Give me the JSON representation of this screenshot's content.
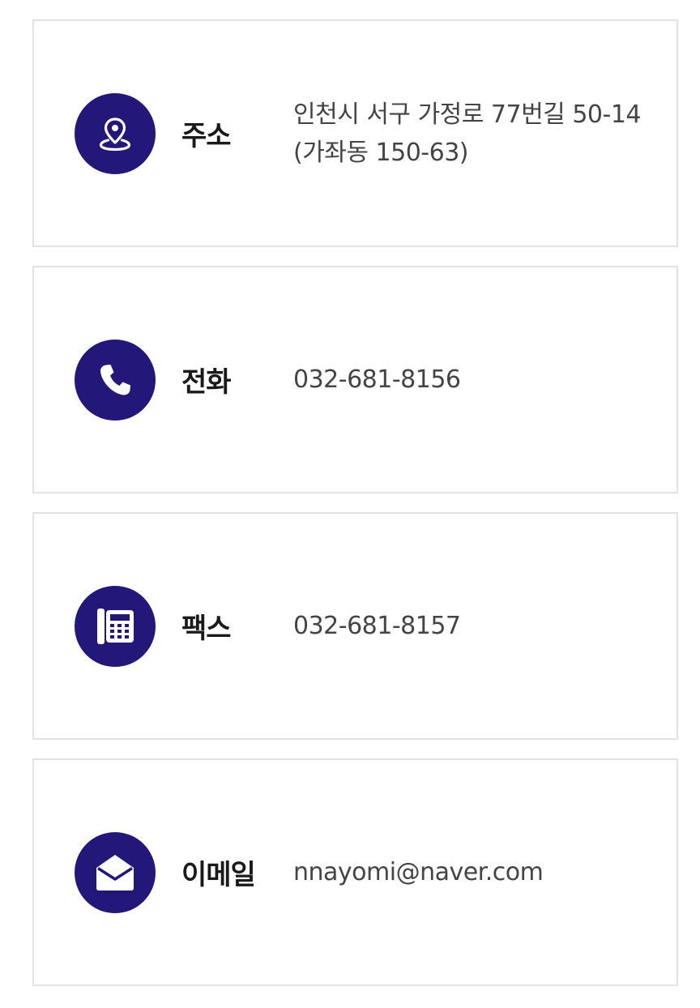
{
  "contact": {
    "address": {
      "icon": "map-pin-icon",
      "label": "주소",
      "line1": "인천시 서구 가정로 77번길 50-14",
      "line2": "(가좌동 150-63)"
    },
    "phone": {
      "icon": "phone-icon",
      "label": "전화",
      "value": "032-681-8156"
    },
    "fax": {
      "icon": "fax-icon",
      "label": "팩스",
      "value": "032-681-8157"
    },
    "email": {
      "icon": "envelope-icon",
      "label": "이메일",
      "value": "nnayomi@naver.com"
    }
  },
  "colors": {
    "icon_background": "#23177a",
    "card_border": "#e2e2e2",
    "label_text": "#1a1a1a",
    "value_text": "#444444"
  }
}
